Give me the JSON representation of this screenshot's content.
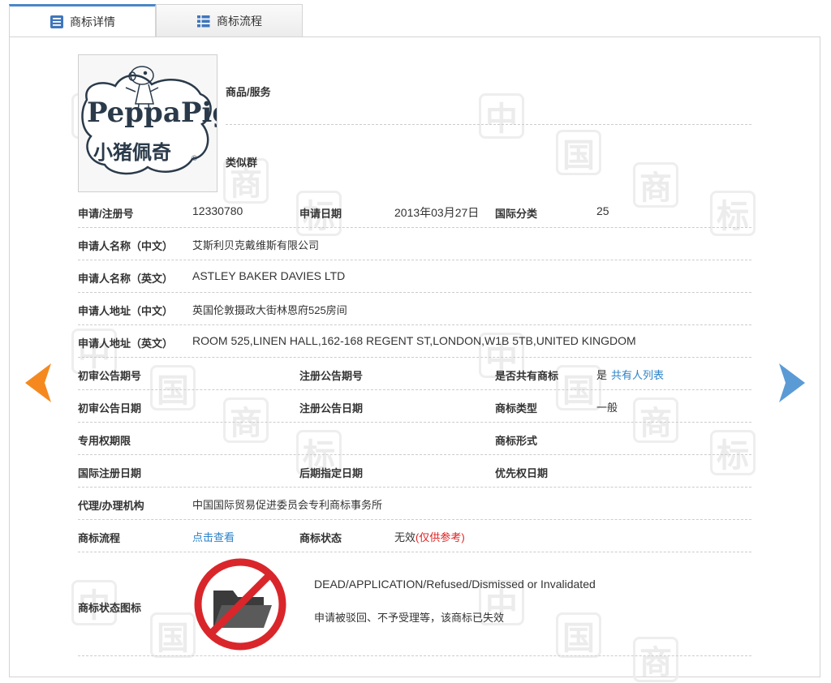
{
  "tabs": [
    {
      "label": "商标详情",
      "icon": "document-list-icon",
      "active": true
    },
    {
      "label": "商标流程",
      "icon": "list-icon",
      "active": false
    }
  ],
  "watermark_chars": [
    "中",
    "国",
    "商",
    "标"
  ],
  "logo": {
    "text_line1": "PeppaPig",
    "text_line2": "小猪佩奇",
    "small_mark": "®"
  },
  "fields": {
    "goods_services_label": "商品/服务",
    "similar_group_label": "类似群",
    "reg_no_label": "申请/注册号",
    "reg_no": "12330780",
    "app_date_label": "申请日期",
    "app_date": "2013年03月27日",
    "intl_class_label": "国际分类",
    "intl_class": "25",
    "applicant_cn_label": "申请人名称（中文）",
    "applicant_cn": "艾斯利贝克戴维斯有限公司",
    "applicant_en_label": "申请人名称（英文）",
    "applicant_en": "ASTLEY BAKER DAVIES LTD",
    "address_cn_label": "申请人地址（中文）",
    "address_cn": "英国伦敦摄政大街林恩府525房间",
    "address_en_label": "申请人地址（英文）",
    "address_en": "ROOM 525,LINEN HALL,162-168 REGENT ST,LONDON,W1B 5TB,UNITED KINGDOM",
    "prelim_pub_no_label": "初审公告期号",
    "reg_pub_no_label": "注册公告期号",
    "shared_label": "是否共有商标",
    "shared_value": "是",
    "shared_link": "共有人列表",
    "prelim_pub_date_label": "初审公告日期",
    "reg_pub_date_label": "注册公告日期",
    "tm_type_label": "商标类型",
    "tm_type": "一般",
    "exclusive_period_label": "专用权期限",
    "tm_form_label": "商标形式",
    "intl_reg_date_label": "国际注册日期",
    "later_designation_label": "后期指定日期",
    "priority_date_label": "优先权日期",
    "agency_label": "代理/办理机构",
    "agency": "中国国际贸易促进委员会专利商标事务所",
    "flow_label": "商标流程",
    "flow_link": "点击查看",
    "status_label": "商标状态",
    "status_value": "无效",
    "status_note": "(仅供参考)",
    "status_icon_label": "商标状态图标",
    "status_en": "DEAD/APPLICATION/Refused/Dismissed or Invalidated",
    "status_cn": "申请被驳回、不予受理等，该商标已失效"
  },
  "colors": {
    "accent_blue": "#2b82c9",
    "arrow_orange": "#f5891f",
    "arrow_blue": "#5b9bd5",
    "status_red": "#d9262b"
  }
}
